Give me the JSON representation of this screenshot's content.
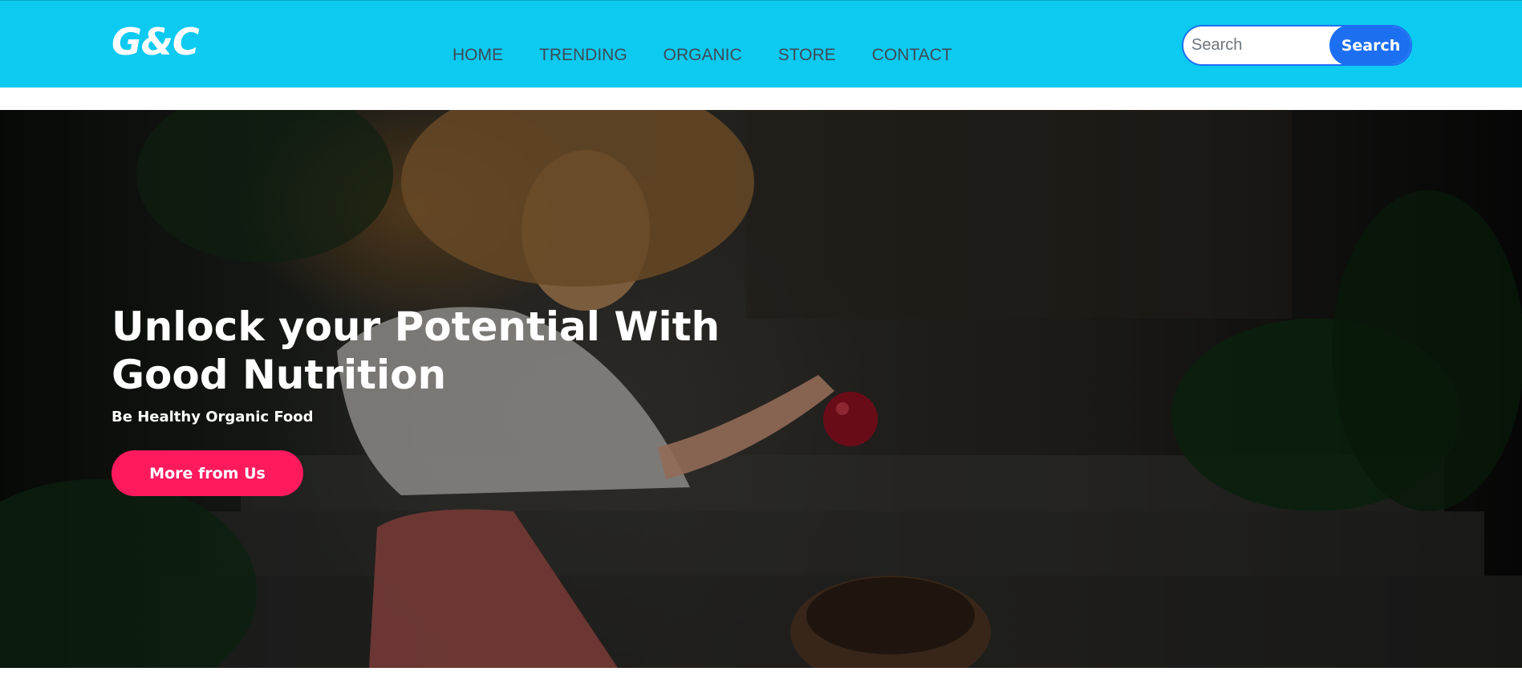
{
  "brand": {
    "logo_text": "G&C"
  },
  "nav": {
    "items": [
      {
        "label": "HOME"
      },
      {
        "label": "TRENDING"
      },
      {
        "label": "ORGANIC"
      },
      {
        "label": "STORE"
      },
      {
        "label": "CONTACT"
      }
    ]
  },
  "search": {
    "placeholder": "Search",
    "value": "",
    "button_label": "Search"
  },
  "hero": {
    "title": "Unlock your Potential With Good Nutrition",
    "subtitle": "Be Healthy Organic Food",
    "button_label": "More from Us"
  },
  "colors": {
    "navbar": "#0dcaf0",
    "search_button": "#1d6ff2",
    "cta_button": "#ff1a5e",
    "nav_text": "#3e4a57"
  }
}
